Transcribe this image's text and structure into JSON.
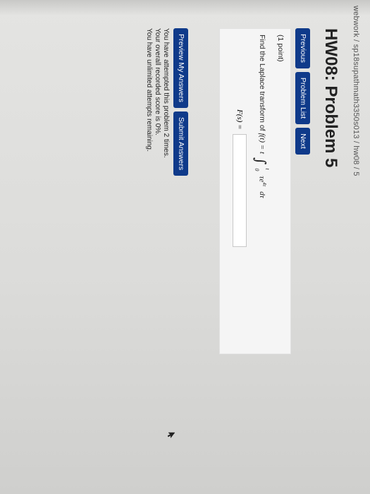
{
  "breadcrumb": "webwork / sp18supathmath3350s013 / hw08 / 5",
  "title": "HW08: Problem 5",
  "nav": {
    "previous": "Previous",
    "problem_list": "Problem List",
    "next": "Next"
  },
  "problem": {
    "points": "(1 point)",
    "prompt": "Find the Laplace transform of",
    "f_of_t": "f(t) = t",
    "integral_upper": "t",
    "integral_lower": "0",
    "integrand": "τe",
    "exponent": "4τ",
    "dtau": "dτ",
    "answer_label": "F(s) ="
  },
  "actions": {
    "preview": "Preview My Answers",
    "submit": "Submit Answers"
  },
  "status": {
    "line1": "You have attempted this problem 2 times.",
    "line2": "Your overall recorded score is 0%.",
    "line3": "You have unlimited attempts remaining."
  },
  "colors": {
    "button_bg": "#0f3a8a",
    "panel_bg": "#f5f5f5"
  },
  "icons": {
    "cursor": "mouse-pointer-icon"
  }
}
